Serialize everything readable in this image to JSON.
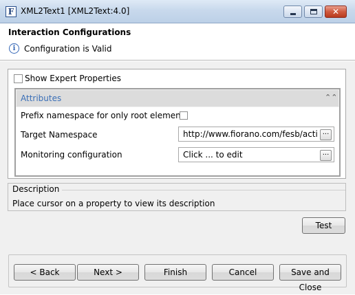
{
  "window": {
    "title": "XML2Text1 [XML2Text:4.0]",
    "app_icon_letter": "F",
    "close_glyph": "✕"
  },
  "header": {
    "title": "Interaction Configurations",
    "status": "Configuration is Valid",
    "info_glyph": "i"
  },
  "properties": {
    "show_expert_label": "Show Expert Properties",
    "show_expert_checked": false,
    "section_title": "Attributes",
    "collapse_glyph": "⌃⌃",
    "rows": [
      {
        "label": "Prefix namespace for only root element?",
        "type": "checkbox",
        "checked": false
      },
      {
        "label": "Target Namespace",
        "type": "text",
        "value": "http://www.fiorano.com/fesb/activit"
      },
      {
        "label": "Monitoring configuration",
        "type": "text",
        "value": "Click ... to edit"
      }
    ],
    "ellipsis": "..."
  },
  "description": {
    "label": "Description",
    "text": "Place cursor on a property to view its description"
  },
  "buttons": {
    "test": "Test",
    "back": "< Back",
    "next": "Next >",
    "finish": "Finish",
    "cancel": "Cancel",
    "save_close": "Save and Close"
  },
  "icons": [
    "app-icon",
    "minimize-icon",
    "maximize-icon",
    "close-icon",
    "info-icon",
    "collapse-icon",
    "ellipsis-icon"
  ]
}
